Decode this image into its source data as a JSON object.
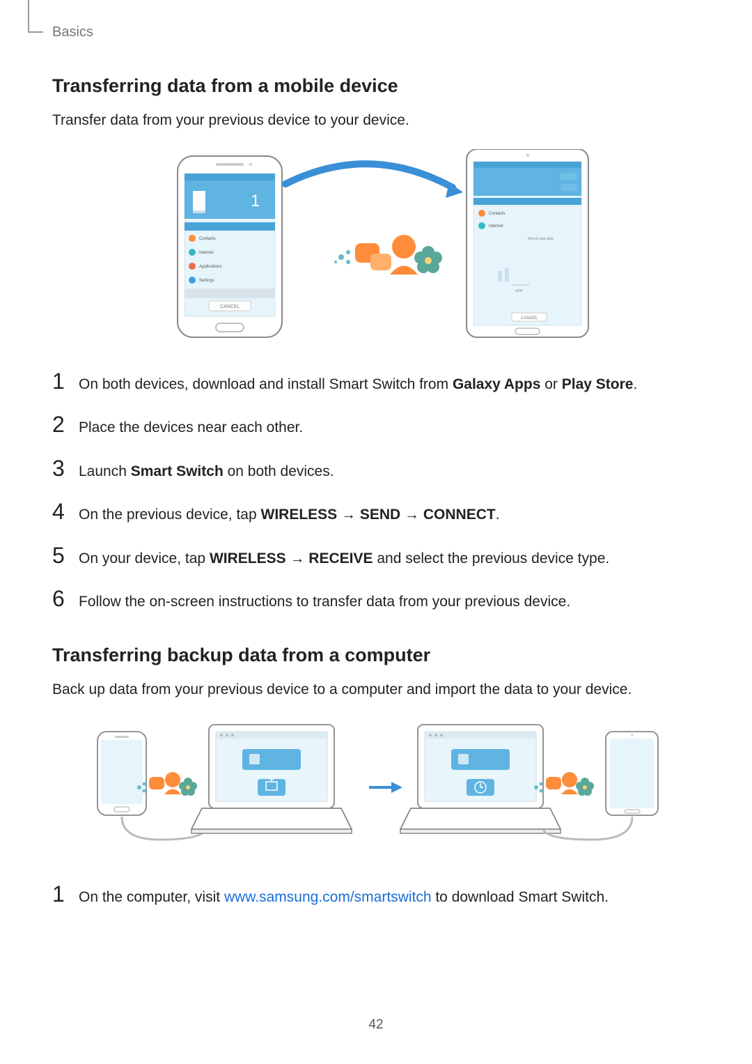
{
  "header": {
    "section": "Basics"
  },
  "page_number": "42",
  "sections": [
    {
      "title": "Transferring data from a mobile device",
      "intro": "Transfer data from your previous device to your device.",
      "figure": "mobile-to-tablet-transfer-illustration",
      "steps": [
        {
          "num": "1",
          "pre": "On both devices, download and install Smart Switch from ",
          "b1": "Galaxy Apps",
          "mid": " or ",
          "b2": "Play Store",
          "post": "."
        },
        {
          "num": "2",
          "text": "Place the devices near each other."
        },
        {
          "num": "3",
          "pre": "Launch ",
          "b1": "Smart Switch",
          "post": " on both devices."
        },
        {
          "num": "4",
          "pre": "On the previous device, tap ",
          "b1": "WIRELESS",
          "arr1": " → ",
          "b2": "SEND",
          "arr2": " → ",
          "b3": "CONNECT",
          "post": "."
        },
        {
          "num": "5",
          "pre": "On your device, tap ",
          "b1": "WIRELESS",
          "arr1": " → ",
          "b2": "RECEIVE",
          "post": " and select the previous device type."
        },
        {
          "num": "6",
          "text": "Follow the on-screen instructions to transfer data from your previous device."
        }
      ]
    },
    {
      "title": "Transferring backup data from a computer",
      "intro": "Back up data from your previous device to a computer and import the data to your device.",
      "figure": "computer-backup-transfer-illustration",
      "steps": [
        {
          "num": "1",
          "pre": "On the computer, visit ",
          "link": "www.samsung.com/smartswitch",
          "post": " to download Smart Switch."
        }
      ]
    }
  ]
}
